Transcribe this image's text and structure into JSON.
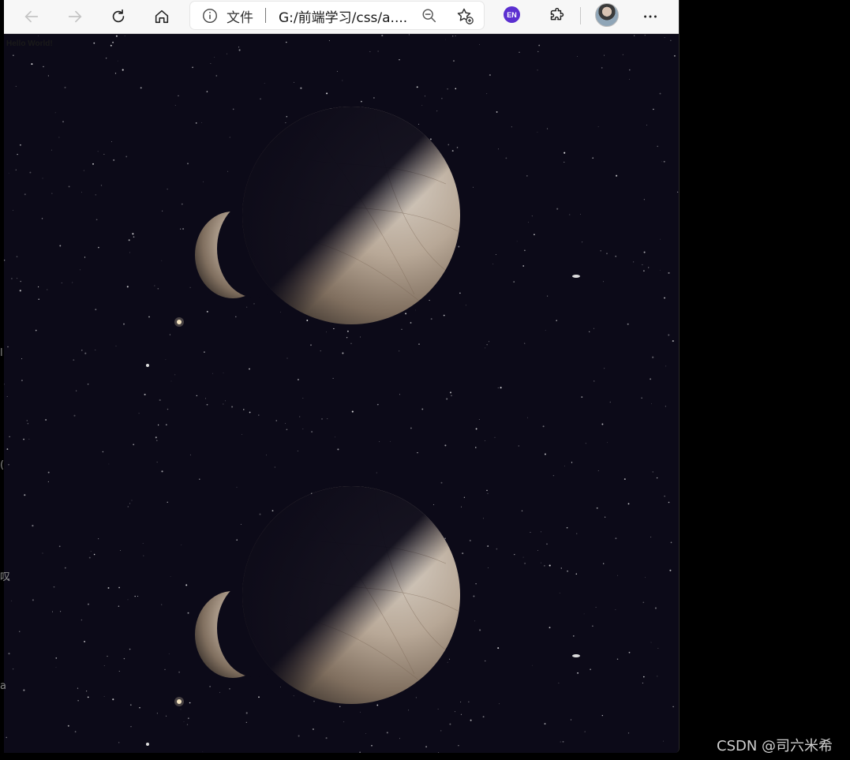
{
  "browser": {
    "address_label": "文件",
    "url": "G:/前端学习/css/a....",
    "translate_badge": "EN"
  },
  "page": {
    "hello_text": "Hello World!"
  },
  "watermark": "CSDN @司六米希",
  "edge_glyphs": [
    "l",
    "(",
    "叹",
    "a"
  ],
  "colors": {
    "space_background": "#0c0a18",
    "planet_light": "#cfc6bb",
    "planet_mid": "#a89682",
    "badge": "#5b2fd0"
  }
}
